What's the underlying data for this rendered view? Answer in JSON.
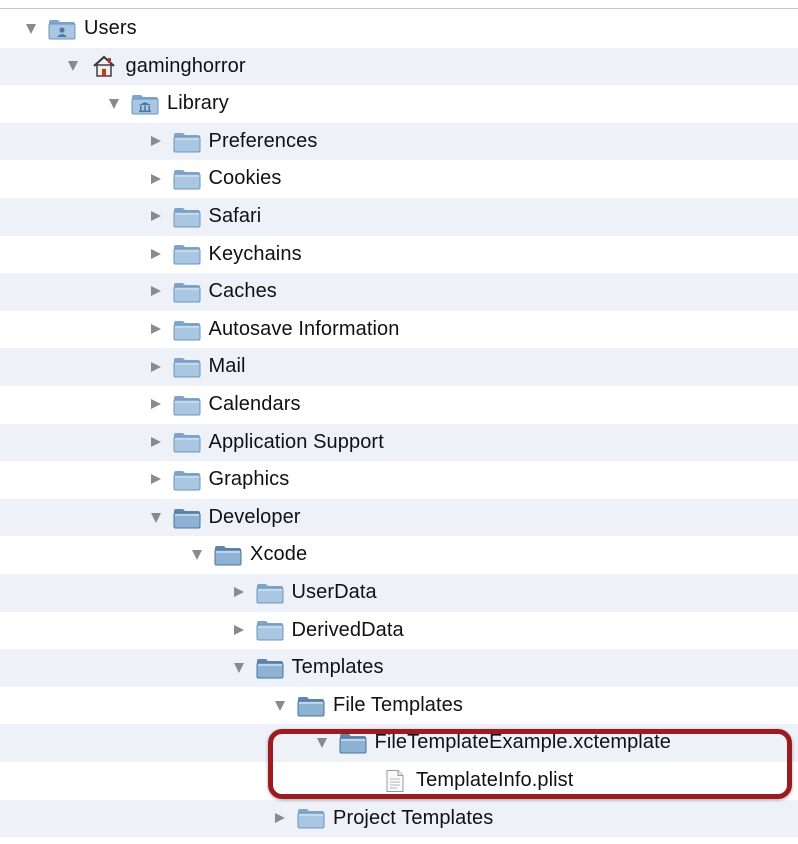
{
  "tree": {
    "rows": [
      {
        "label": "Users",
        "icon": "users-folder-icon",
        "expanded": true
      },
      {
        "label": "gaminghorror",
        "icon": "home-icon",
        "expanded": true
      },
      {
        "label": "Library",
        "icon": "library-folder-icon",
        "expanded": true
      },
      {
        "label": "Preferences",
        "icon": "folder-icon",
        "expanded": false
      },
      {
        "label": "Cookies",
        "icon": "folder-icon",
        "expanded": false
      },
      {
        "label": "Safari",
        "icon": "folder-icon",
        "expanded": false
      },
      {
        "label": "Keychains",
        "icon": "folder-icon",
        "expanded": false
      },
      {
        "label": "Caches",
        "icon": "folder-icon",
        "expanded": false
      },
      {
        "label": "Autosave Information",
        "icon": "folder-icon",
        "expanded": false
      },
      {
        "label": "Mail",
        "icon": "folder-icon",
        "expanded": false
      },
      {
        "label": "Calendars",
        "icon": "folder-icon",
        "expanded": false
      },
      {
        "label": "Application Support",
        "icon": "folder-icon",
        "expanded": false
      },
      {
        "label": "Graphics",
        "icon": "folder-icon",
        "expanded": false
      },
      {
        "label": "Developer",
        "icon": "folder-icon",
        "expanded": true
      },
      {
        "label": "Xcode",
        "icon": "folder-icon",
        "expanded": true
      },
      {
        "label": "UserData",
        "icon": "folder-icon",
        "expanded": false
      },
      {
        "label": "DerivedData",
        "icon": "folder-icon",
        "expanded": false
      },
      {
        "label": "Templates",
        "icon": "folder-icon",
        "expanded": true
      },
      {
        "label": "File Templates",
        "icon": "folder-icon",
        "expanded": true
      },
      {
        "label": "FileTemplateExample.xctemplate",
        "icon": "folder-icon",
        "expanded": true
      },
      {
        "label": "TemplateInfo.plist",
        "icon": "document-icon",
        "expanded": null
      },
      {
        "label": "Project Templates",
        "icon": "folder-icon",
        "expanded": false
      }
    ]
  },
  "colors": {
    "alt_row": "#eef2f8",
    "highlight_border": "#9b1c1f",
    "folder_blue": "#9fc0dc"
  }
}
